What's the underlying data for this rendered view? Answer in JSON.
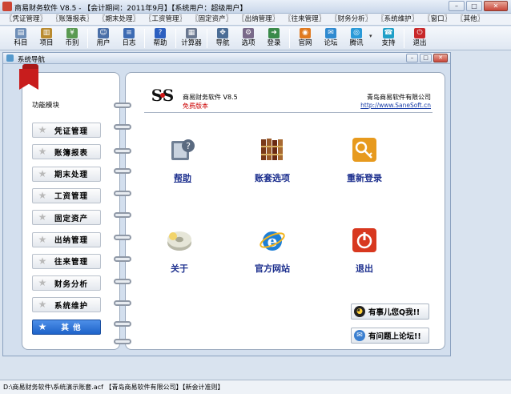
{
  "window": {
    "title": "商易财务软件 V8.5 - 【会计期间：2011年9月】【系统用户：超级用户】",
    "buttons": {
      "minimize": "–",
      "maximize": "□",
      "close": "✕"
    }
  },
  "menu": [
    "〖凭证管理〗",
    "〖账簿报表〗",
    "〖期末处理〗",
    "〖工资管理〗",
    "〖固定资产〗",
    "〖出纳管理〗",
    "〖往来管理〗",
    "〖财务分析〗",
    "〖系统维护〗",
    "〖窗口〗",
    "〖其他〗"
  ],
  "toolbar": [
    {
      "label": "科目",
      "icon": "notebook-icon",
      "color": "#6f8fb8",
      "glyph": "▤"
    },
    {
      "label": "项目",
      "icon": "folder-icon",
      "color": "#b98a2e",
      "glyph": "▥"
    },
    {
      "label": "币别",
      "icon": "currency-icon",
      "color": "#5a9a52",
      "glyph": "¥"
    },
    {
      "sep": true
    },
    {
      "label": "用户",
      "icon": "user-icon",
      "color": "#4a6fa8",
      "glyph": "☺"
    },
    {
      "label": "日志",
      "icon": "log-icon",
      "color": "#3d6bb3",
      "glyph": "≡"
    },
    {
      "sep": true
    },
    {
      "label": "帮助",
      "icon": "help-icon",
      "color": "#2c5fc0",
      "glyph": "?"
    },
    {
      "sep": true
    },
    {
      "label": "计算器",
      "icon": "calculator-icon",
      "color": "#6a7890",
      "glyph": "▦"
    },
    {
      "sep": true
    },
    {
      "label": "导航",
      "icon": "navigation-icon",
      "color": "#4b6d96",
      "glyph": "✥"
    },
    {
      "label": "选项",
      "icon": "options-icon",
      "color": "#7a6a8a",
      "glyph": "⚙"
    },
    {
      "label": "登录",
      "icon": "login-icon",
      "color": "#3a8a4a",
      "glyph": "➜"
    },
    {
      "sep": true
    },
    {
      "label": "官网",
      "icon": "rss-icon",
      "color": "#e07a20",
      "glyph": "◉"
    },
    {
      "label": "论坛",
      "icon": "forum-icon",
      "color": "#2f8ad0",
      "glyph": "✉"
    },
    {
      "label": "腾讯",
      "icon": "qq-icon",
      "color": "#2a9ad8",
      "glyph": "◎"
    },
    {
      "drop": true
    },
    {
      "label": "支持",
      "icon": "support-icon",
      "color": "#1fa0c8",
      "glyph": "☎"
    },
    {
      "sep": true
    },
    {
      "label": "退出",
      "icon": "exit-icon",
      "color": "#c8282a",
      "glyph": "⏻"
    }
  ],
  "nav_window": {
    "title": "系统导航",
    "buttons": {
      "minimize": "–",
      "maximize": "□",
      "close": "✕"
    }
  },
  "left": {
    "module_label": "功能模块",
    "items": [
      "凭证管理",
      "账簿报表",
      "期末处理",
      "工资管理",
      "固定资产",
      "出纳管理",
      "往来管理",
      "财务分析",
      "系统维护",
      "其 他"
    ],
    "active_index": 9
  },
  "header": {
    "logo_text": "SS",
    "software": "商易财务软件 V8.5",
    "edition": "免费版本",
    "company": "青岛商易软件有限公司",
    "website": "http://www.SaneSoft.cn"
  },
  "features": [
    {
      "label": "帮助",
      "icon": "help-book-icon",
      "link": true
    },
    {
      "label": "账套选项",
      "icon": "books-icon",
      "link": false
    },
    {
      "label": "重新登录",
      "icon": "key-icon",
      "link": false
    },
    {
      "label": "关于",
      "icon": "about-disk-icon",
      "link": false
    },
    {
      "label": "官方网站",
      "icon": "ie-browser-icon",
      "link": false
    },
    {
      "label": "退出",
      "icon": "power-icon",
      "link": false
    }
  ],
  "chat": [
    {
      "label": "有事儿您Q我!!",
      "icon": "qq-penguin-icon"
    },
    {
      "label": "有问题上论坛!!",
      "icon": "forum-globe-icon"
    }
  ],
  "status": "D:\\商易财务软件\\系统演示账套.acf 【青岛商易软件有限公司】【新会计准则】"
}
